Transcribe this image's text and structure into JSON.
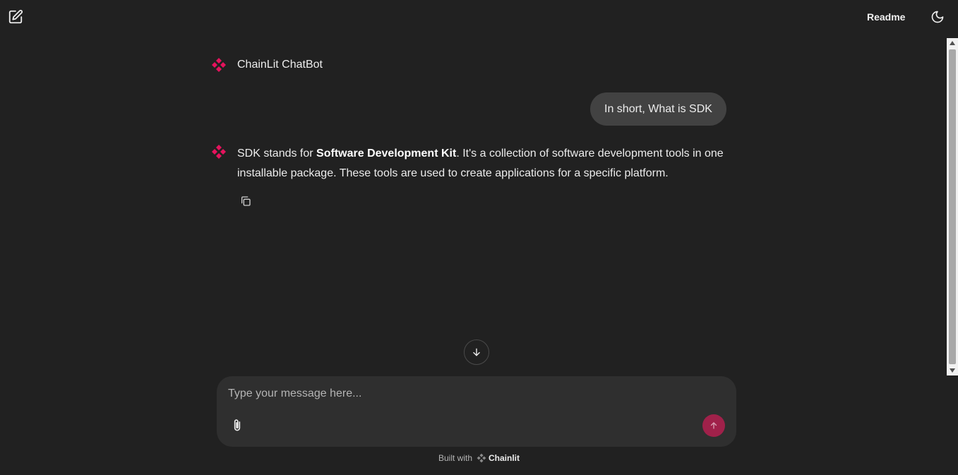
{
  "header": {
    "new_chat_icon": "edit-square-icon",
    "readme_label": "Readme",
    "theme_icon": "moon-icon"
  },
  "chat": {
    "assistant_name": "ChainLit ChatBot",
    "messages": [
      {
        "role": "user",
        "text": "In short, What is SDK"
      },
      {
        "role": "assistant",
        "text_before": "SDK stands for ",
        "text_bold": "Software Development Kit",
        "text_after": ". It's a collection of software development tools in one installable package. These tools are used to create applications for a specific platform."
      }
    ]
  },
  "composer": {
    "placeholder": "Type your message here...",
    "value": ""
  },
  "footer": {
    "built_with": "Built with",
    "brand": "Chainlit"
  },
  "colors": {
    "background": "#212121",
    "accent": "#e5135d",
    "send_button": "#a0214a",
    "user_bubble": "#424242",
    "composer": "#2f2f2f"
  }
}
